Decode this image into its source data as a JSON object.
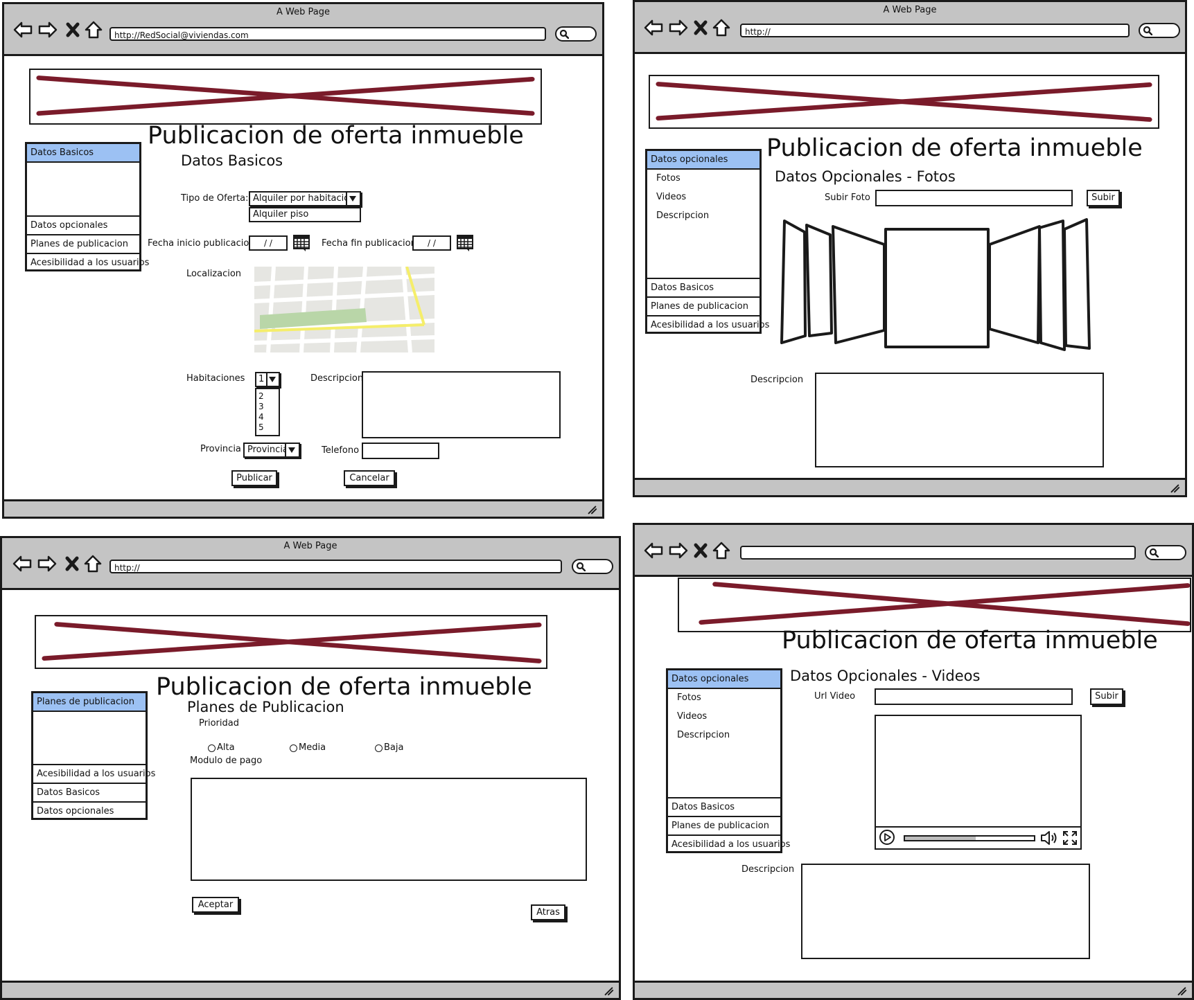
{
  "common": {
    "window_title": "A Web Page",
    "page_title": "Publicacion de oferta inmueble"
  },
  "win1": {
    "url": "http://RedSocial@viviendas.com",
    "section_title": "Datos Basicos",
    "sidebar": {
      "active": "Datos Basicos",
      "items": [
        "Datos opcionales",
        "Planes de publicacion",
        "Acesibilidad a los usuarios"
      ]
    },
    "tipo_oferta_label": "Tipo de Oferta:",
    "tipo_oferta_selected": "Alquiler por habitacion",
    "tipo_oferta_option": "Alquiler piso",
    "fecha_inicio_label": "Fecha inicio publicacion",
    "fecha_inicio_value": "/ /",
    "fecha_fin_label": "Fecha fin publicacion",
    "fecha_fin_value": "/ /",
    "localizacion_label": "Localizacion",
    "habitaciones_label": "Habitaciones",
    "habitaciones_selected": "1",
    "habitaciones_options": [
      "2",
      "3",
      "4",
      "5"
    ],
    "descripcion_label": "Descripcion",
    "provincia_label": "Provincia",
    "provincia_selected": "Provincia",
    "telefono_label": "Telefono",
    "publicar_button": "Publicar",
    "cancelar_button": "Cancelar"
  },
  "win2": {
    "url": "http://",
    "section_title": "Datos Opcionales - Fotos",
    "sidebar": {
      "active": "Datos opcionales",
      "subitems": [
        "Fotos",
        "Videos",
        "Descripcion"
      ],
      "items": [
        "Datos Basicos",
        "Planes de publicacion",
        "Acesibilidad a los usuarios"
      ]
    },
    "subir_foto_label": "Subir Foto",
    "subir_button": "Subir",
    "descripcion_label": "Descripcion"
  },
  "win3": {
    "url": "http://",
    "section_title": "Planes de Publicacion",
    "sidebar": {
      "active": "Planes de publicacion",
      "items": [
        "Acesibilidad a los usuarios",
        "Datos Basicos",
        "Datos opcionales"
      ]
    },
    "prioridad_label": "Prioridad",
    "radio_options": [
      "Alta",
      "Media",
      "Baja"
    ],
    "modulo_pago_label": "Modulo de pago",
    "aceptar_button": "Aceptar",
    "atras_button": "Atras"
  },
  "win4": {
    "url": "",
    "section_title": "Datos Opcionales - Videos",
    "sidebar": {
      "active": "Datos opcionales",
      "subitems": [
        "Fotos",
        "Videos",
        "Descripcion"
      ],
      "items": [
        "Datos Basicos",
        "Planes de publicacion",
        "Acesibilidad a los usuarios"
      ]
    },
    "url_video_label": "Url Video",
    "subir_button": "Subir",
    "descripcion_label": "Descripcion",
    "video_progress": 0.55
  },
  "colors": {
    "chrome_gray": "#c4c4c4",
    "sidebar_active": "#9cc1f3",
    "banner_x": "#7a1b2a",
    "map_road_yellow": "#f5ee6a",
    "map_park": "#b9d6a8"
  },
  "icons": [
    "back-arrow-icon",
    "forward-arrow-icon",
    "close-icon",
    "home-icon",
    "search-icon",
    "calendar-icon",
    "play-icon",
    "volume-icon",
    "fullscreen-icon",
    "resize-grip-icon"
  ]
}
